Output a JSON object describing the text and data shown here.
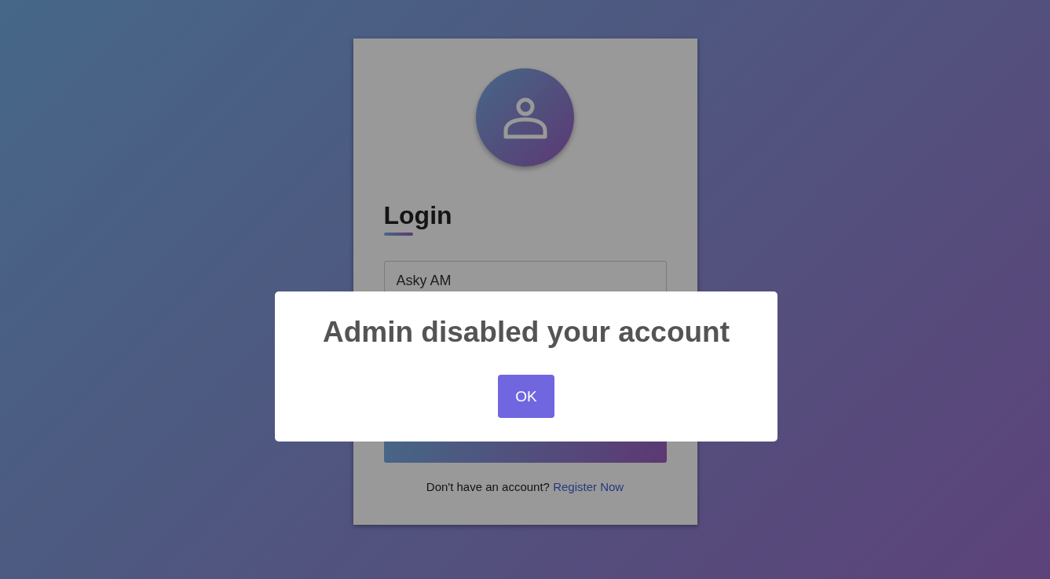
{
  "login_form": {
    "heading": "Login",
    "username": {
      "value": "Asky AM"
    },
    "register_prompt": "Don't have an account?",
    "register_link": "Register Now"
  },
  "dialog": {
    "message": "Admin disabled your account",
    "buttons": [
      "OK"
    ]
  }
}
